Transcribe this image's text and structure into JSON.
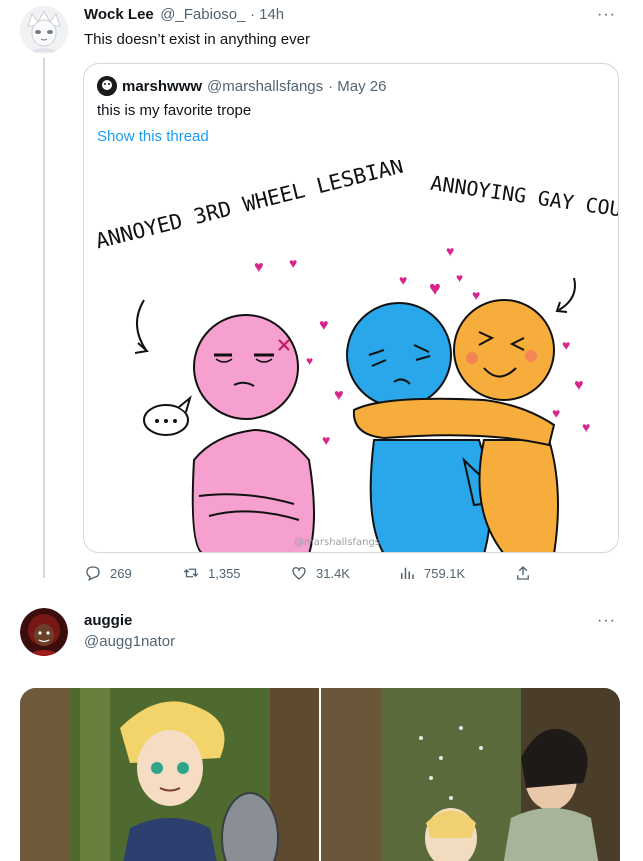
{
  "tweet1": {
    "author_name": "Wock Lee",
    "handle": "@_Fabioso_",
    "time": "· 14h",
    "text": "This doesn’t exist in anything ever",
    "more_label": "···",
    "quote": {
      "author_name": "marshwww",
      "handle": "@marshallsfangs",
      "date": "· May 26",
      "text": "this is my favorite trope",
      "show_thread": "Show this thread",
      "image": {
        "caption_left": "ANNOYED 3RD WHEEL LESBIAN",
        "caption_right": "ANNOYING GAY COUPLE",
        "watermark": "@marshallsfangs",
        "colors": {
          "pink": "#f5a0cf",
          "blue": "#2aa6ea",
          "orange": "#f7ad3b",
          "heart": "#d8258d"
        }
      }
    },
    "actions": {
      "replies": "269",
      "retweets": "1,355",
      "likes": "31.4K",
      "views": "759.1K"
    }
  },
  "tweet2": {
    "author_name": "auggie",
    "handle": "@augg1nator",
    "more_label": "···"
  },
  "colors": {
    "accent": "#1d9bf0",
    "muted": "#536471",
    "border": "#cfd9de"
  }
}
